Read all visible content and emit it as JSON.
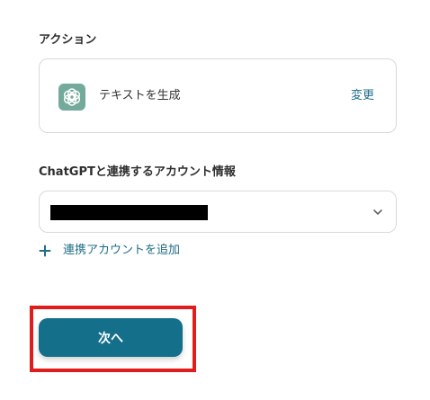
{
  "action_section": {
    "label": "アクション",
    "action_name": "テキストを生成",
    "change_label": "変更",
    "app_icon": "openai-icon",
    "app_icon_color": "#74aa9c"
  },
  "account_section": {
    "label": "ChatGPTと連携するアカウント情報",
    "selected_value": "",
    "selected_value_redacted": true,
    "dropdown_icon": "chevron-down-icon",
    "add_account_icon": "plus-icon",
    "add_account_label": "連携アカウントを追加"
  },
  "footer": {
    "next_label": "次へ",
    "next_button_color": "#146f8a",
    "highlight_color": "#e01c1c"
  }
}
